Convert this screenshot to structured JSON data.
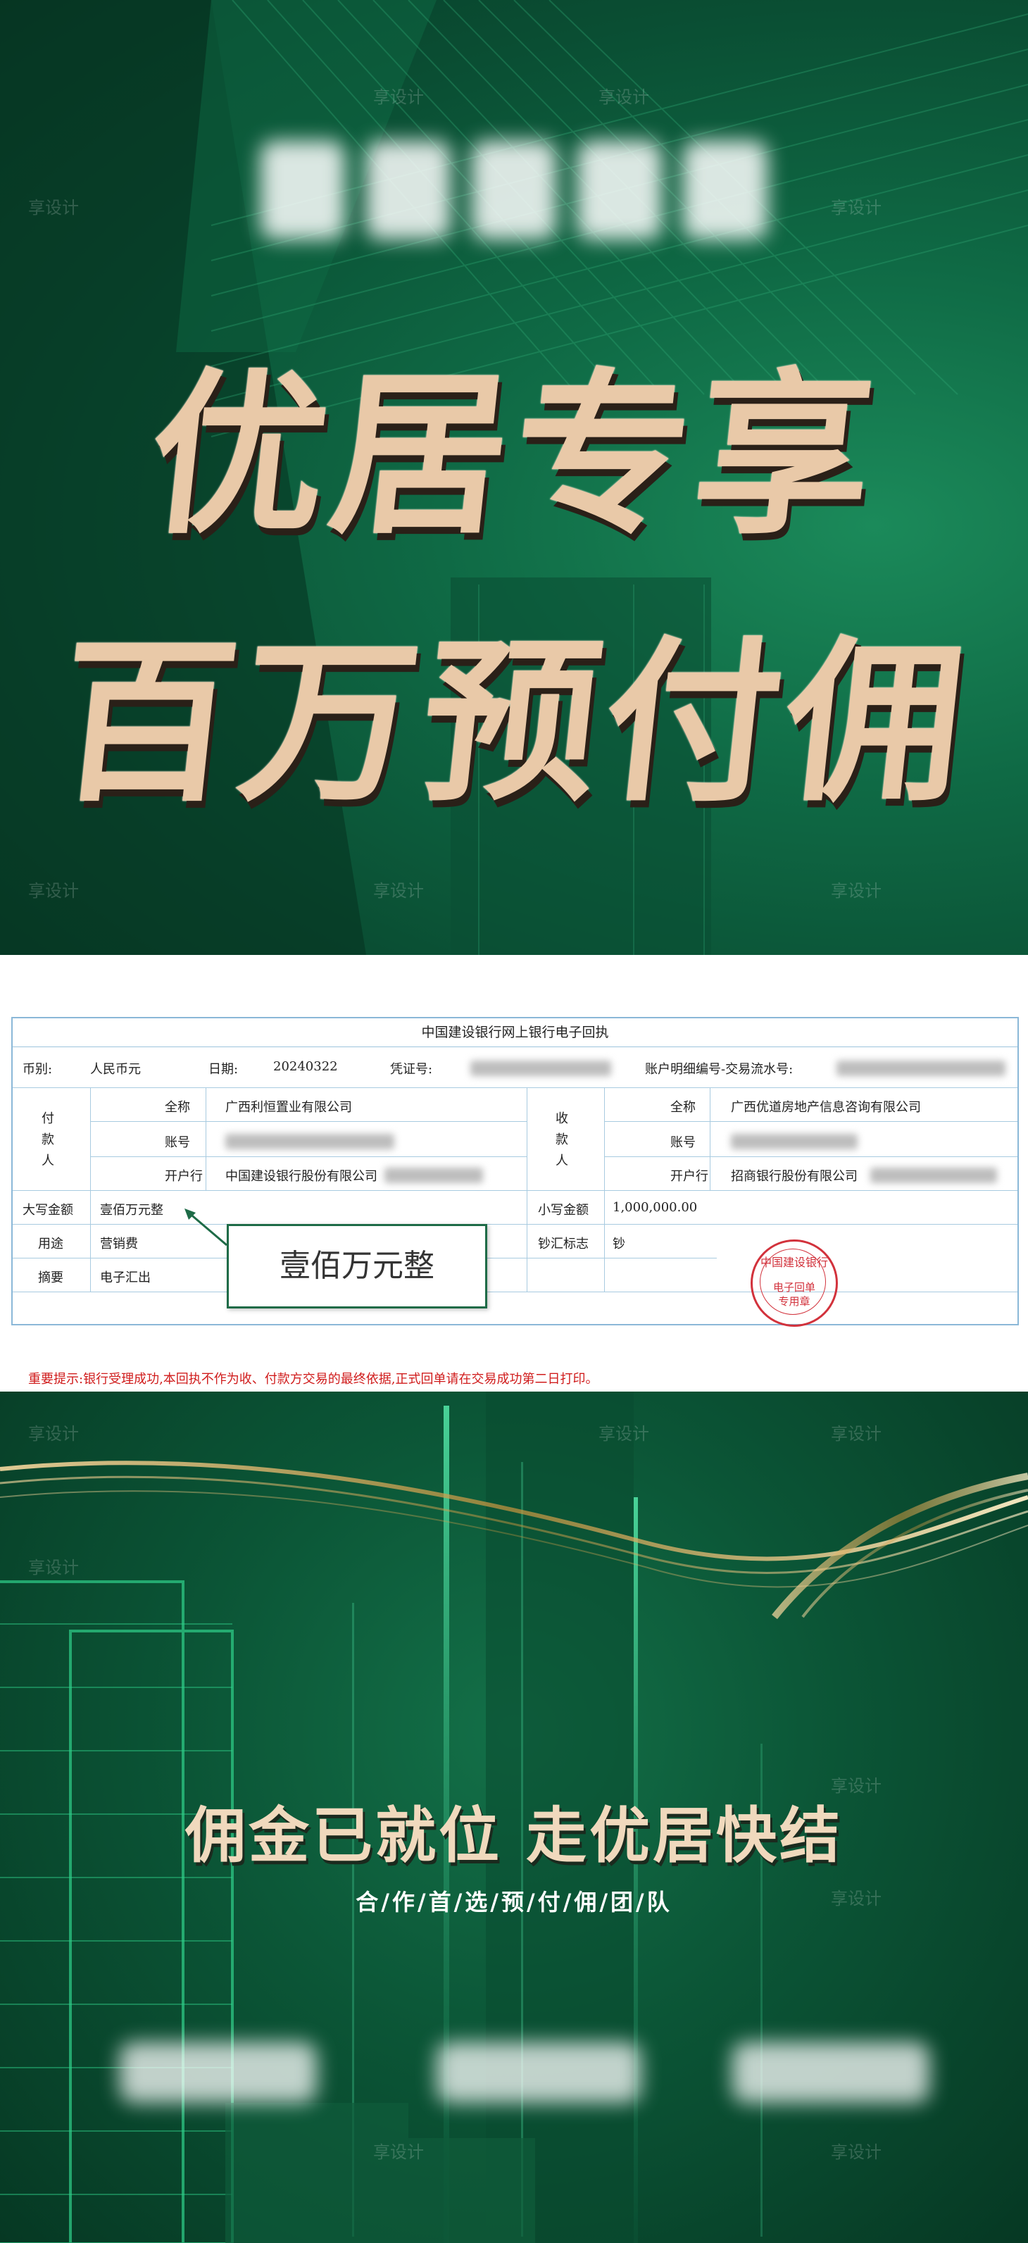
{
  "headline": {
    "line1": "优居专享",
    "line2": "百万预付佣"
  },
  "watermark": "享设计",
  "receipt": {
    "title": "中国建设银行网上银行电子回执",
    "currency_label": "币别:",
    "currency_value": "人民币元",
    "date_label": "日期:",
    "date_value": "20240322",
    "voucher_label": "凭证号:",
    "account_serial_label": "账户明细编号-交易流水号:",
    "payer": {
      "label": "付款人",
      "name_label": "全称",
      "name_value": "广西利恒置业有限公司",
      "account_label": "账号",
      "bank_label": "开户行",
      "bank_value": "中国建设银行股份有限公司"
    },
    "payee": {
      "label": "收款人",
      "name_label": "全称",
      "name_value": "广西优道房地产信息咨询有限公司",
      "account_label": "账号",
      "bank_label": "开户行",
      "bank_value": "招商银行股份有限公司"
    },
    "amount_upper_label": "大写金额",
    "amount_upper_value": "壹佰万元整",
    "amount_lower_label": "小写金额",
    "amount_lower_value": "1,000,000.00",
    "purpose_label": "用途",
    "purpose_value": "营销费",
    "cash_flag_label": "钞汇标志",
    "cash_flag_value": "钞",
    "summary_label": "摘要",
    "summary_value": "电子汇出",
    "notice": "重要提示:银行受理成功,本回执不作为收、付款方交易的最终依据,正式回单请在交易成功第二日打印。",
    "stamp": {
      "arc": "中国建设银行",
      "line1": "电子回单",
      "line2": "专用章"
    },
    "callout": "壹佰万元整"
  },
  "slogan": "佣金已就位 走优居快结",
  "subline": "合/作/首/选/预/付/佣/团/队",
  "colors": {
    "gold": "#e9c9a8",
    "green_dark": "#073b27",
    "green": "#0f6a45",
    "receipt_border": "#8bb8d8",
    "stamp_red": "#d2323c"
  }
}
